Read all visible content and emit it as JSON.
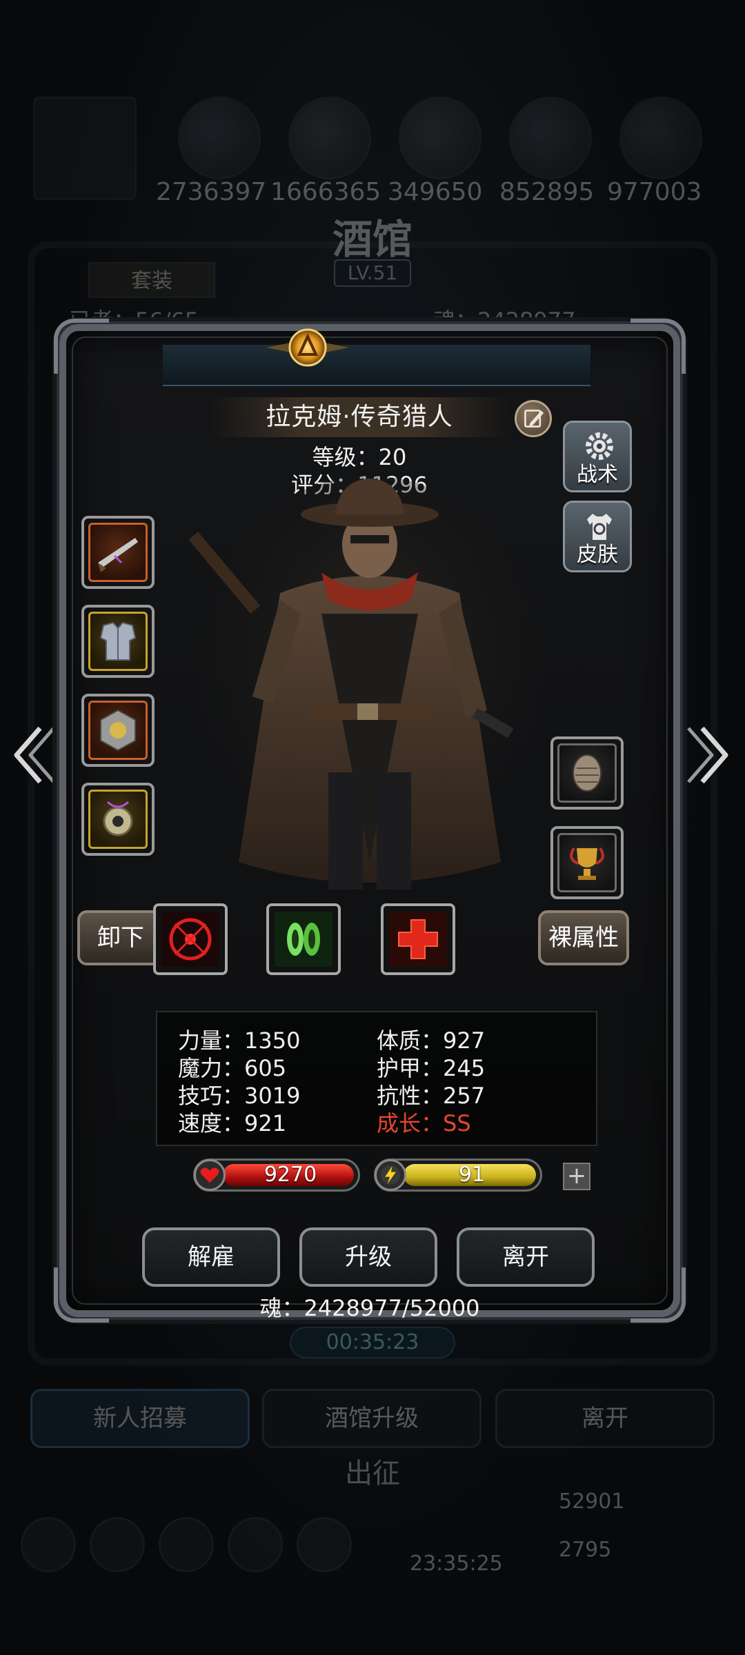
{
  "background": {
    "resources": [
      "2736397",
      "1666365",
      "349650",
      "852895",
      "977003"
    ],
    "title": "酒馆",
    "level": "LV.51",
    "suit_tab": "套装",
    "line_left": "已",
    "line_left_tail": "者：56/65",
    "line_right": "魂：2428977",
    "timer": "00:35:23",
    "buttons": [
      "新人招募",
      "酒馆升级",
      "离开"
    ],
    "go_label": "出征",
    "clock": "23:35:25",
    "currency_1": "52901",
    "currency_2": "2795"
  },
  "hero": {
    "name": "拉克姆·传奇猎人",
    "level_text": "等级：20",
    "score_text": "评分：11296"
  },
  "side_buttons": {
    "tactics": "战术",
    "skin": "皮肤"
  },
  "actions": {
    "unequip": "卸下",
    "bare_attr": "裸属性"
  },
  "stats": {
    "strength": "力量：1350",
    "magic": "魔力：605",
    "skill": "技巧：3019",
    "speed": "速度：921",
    "constitution": "体质：927",
    "armor": "护甲：245",
    "resistance": "抗性：257",
    "growth": "成长：SS"
  },
  "bars": {
    "hp": "9270",
    "energy": "91",
    "plus": "+"
  },
  "bottom_buttons": {
    "dismiss": "解雇",
    "upgrade": "升级",
    "leave": "离开"
  },
  "soul_text": "魂：2428977/52000",
  "colors": {
    "hp": "#c01818",
    "energy": "#c9b21c",
    "growth": "#e8452c",
    "panel_border": "#5b6066"
  }
}
